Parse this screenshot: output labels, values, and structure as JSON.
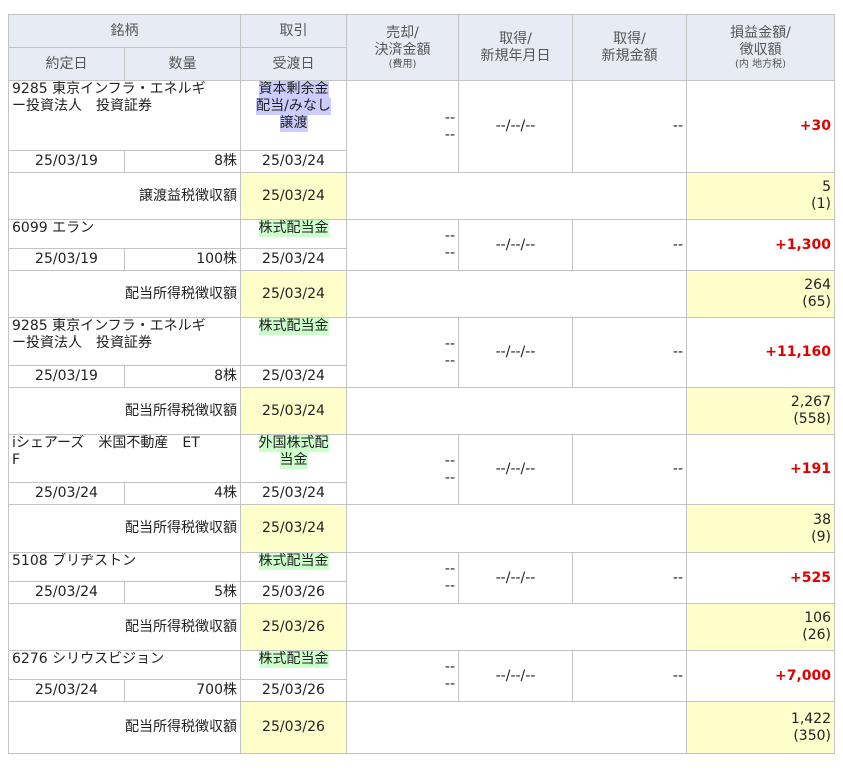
{
  "headers": {
    "stock": "銘柄",
    "trade": "取引",
    "settlement_amount": [
      "売却/",
      "決済金額"
    ],
    "settlement_note": "(費用)",
    "acq_date": [
      "取得/",
      "新規年月日"
    ],
    "acq_amount": [
      "取得/",
      "新規金額"
    ],
    "pl_amount": [
      "損益金額/",
      "徴収額"
    ],
    "pl_note": "(内 地方税)",
    "contract_date": "約定日",
    "quantity": "数量",
    "delivery_date": "受渡日"
  },
  "colors": {
    "profit": "#e00000",
    "header_bg": "#e7ecf4",
    "tax_bg": "#ffffcc",
    "tag_purple": "#ccccff",
    "tag_green": "#ccffcc"
  },
  "transactions": [
    {
      "stock_lines": [
        "9285 東京インフラ・エネルギ",
        "ー投資法人　投資証券"
      ],
      "type_lines": [
        "資本剰余金",
        "配当/みなし",
        "譲渡"
      ],
      "type_color": "purple",
      "contract_date": "25/03/19",
      "quantity": "8株",
      "delivery_date": "25/03/24",
      "settle": [
        "--",
        "--"
      ],
      "acq_date": "--/--/--",
      "acq_amount": "--",
      "pl": "+30",
      "tax": {
        "label": "譲渡益税徴収額",
        "date": "25/03/24",
        "amount": "5",
        "local": "(1)"
      }
    },
    {
      "stock_lines": [
        "6099 エラン"
      ],
      "type_lines": [
        "株式配当金"
      ],
      "type_color": "green",
      "contract_date": "25/03/19",
      "quantity": "100株",
      "delivery_date": "25/03/24",
      "settle": [
        "--",
        "--"
      ],
      "acq_date": "--/--/--",
      "acq_amount": "--",
      "pl": "+1,300",
      "tax": {
        "label": "配当所得税徴収額",
        "date": "25/03/24",
        "amount": "264",
        "local": "(65)"
      }
    },
    {
      "stock_lines": [
        "9285 東京インフラ・エネルギ",
        "ー投資法人　投資証券"
      ],
      "type_lines": [
        "株式配当金"
      ],
      "type_color": "green",
      "contract_date": "25/03/19",
      "quantity": "8株",
      "delivery_date": "25/03/24",
      "settle": [
        "--",
        "--"
      ],
      "acq_date": "--/--/--",
      "acq_amount": "--",
      "pl": "+11,160",
      "tax": {
        "label": "配当所得税徴収額",
        "date": "25/03/24",
        "amount": "2,267",
        "local": "(558)"
      }
    },
    {
      "stock_lines": [
        "iシェアーズ　米国不動産　ET",
        "F"
      ],
      "type_lines": [
        "外国株式配",
        "当金"
      ],
      "type_color": "green",
      "contract_date": "25/03/24",
      "quantity": "4株",
      "delivery_date": "25/03/24",
      "settle": [
        "--",
        "--"
      ],
      "acq_date": "--/--/--",
      "acq_amount": "--",
      "pl": "+191",
      "tax": {
        "label": "配当所得税徴収額",
        "date": "25/03/24",
        "amount": "38",
        "local": "(9)"
      }
    },
    {
      "stock_lines": [
        "5108 ブリヂストン"
      ],
      "type_lines": [
        "株式配当金"
      ],
      "type_color": "green",
      "contract_date": "25/03/24",
      "quantity": "5株",
      "delivery_date": "25/03/26",
      "settle": [
        "--",
        "--"
      ],
      "acq_date": "--/--/--",
      "acq_amount": "--",
      "pl": "+525",
      "tax": {
        "label": "配当所得税徴収額",
        "date": "25/03/26",
        "amount": "106",
        "local": "(26)"
      }
    },
    {
      "stock_lines": [
        "6276 シリウスビジョン"
      ],
      "type_lines": [
        "株式配当金"
      ],
      "type_color": "green",
      "contract_date": "25/03/24",
      "quantity": "700株",
      "delivery_date": "25/03/26",
      "settle": [
        "--",
        "--"
      ],
      "acq_date": "--/--/--",
      "acq_amount": "--",
      "pl": "+7,000",
      "tax": {
        "label": "配当所得税徴収額",
        "date": "25/03/26",
        "amount": "1,422",
        "local": "(350)"
      }
    }
  ]
}
